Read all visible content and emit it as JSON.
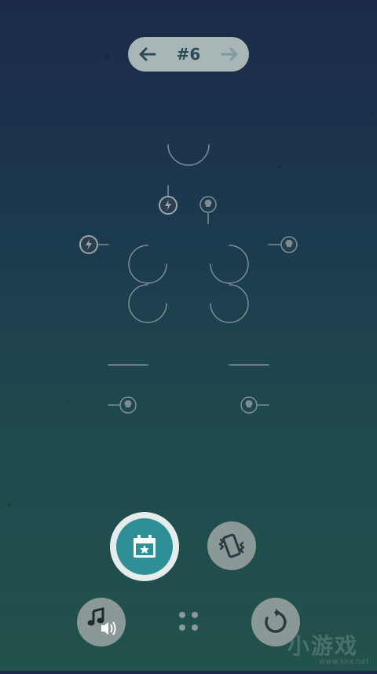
{
  "level": {
    "label": "#6",
    "prev_icon": "arrow-left-icon",
    "next_icon": "arrow-right-icon"
  },
  "controls": {
    "daily_icon": "calendar-star-icon",
    "vibrate_icon": "vibrate-phone-icon",
    "sound_icon": "music-sound-icon",
    "levels_icon": "grid-dots-icon",
    "restart_icon": "restart-icon"
  },
  "colors": {
    "accent": "#2e8f96",
    "button_gray": "#8a9898",
    "puzzle_line": "#7d8e95",
    "power_node": "#9aa8ab"
  },
  "watermark": {
    "main": "小游戏",
    "url": "www.kkx.net"
  }
}
